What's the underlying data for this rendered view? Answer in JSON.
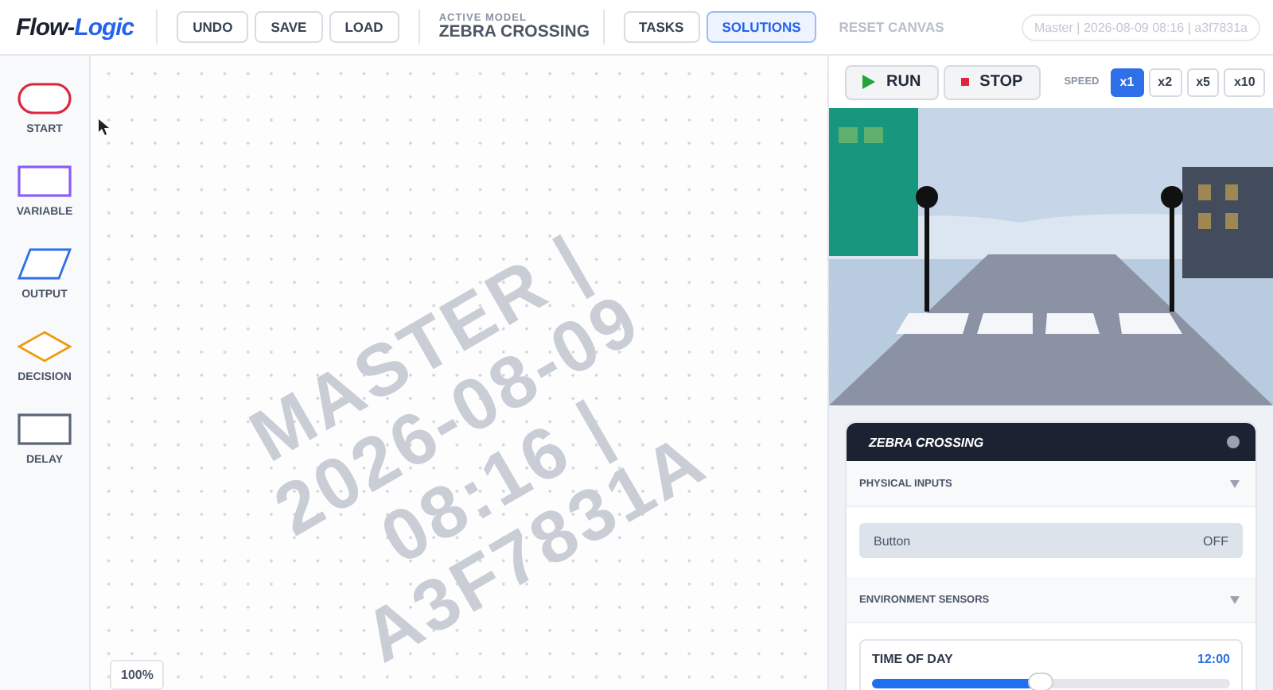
{
  "header": {
    "logo": {
      "part_1": "Flow-",
      "part_2": "Logic"
    },
    "buttons": [
      "UNDO",
      "SAVE",
      "LOAD"
    ],
    "model_label": "ACTIVE MODEL",
    "model_name": "ZEBRA CROSSING",
    "nav": [
      {
        "label": "TASKS",
        "selected": false,
        "disabled": false
      },
      {
        "label": "SOLUTIONS",
        "selected": true,
        "disabled": false
      },
      {
        "label": "RESET CANVAS",
        "selected": false,
        "disabled": true
      }
    ],
    "version": "Master | 2026-08-09 08:16 | a3f7831a"
  },
  "palette": [
    {
      "kind": "start",
      "label": "START"
    },
    {
      "kind": "variable",
      "label": "VARIABLE"
    },
    {
      "kind": "output",
      "label": "OUTPUT"
    },
    {
      "kind": "decision",
      "label": "DECISION"
    },
    {
      "kind": "delay",
      "label": "DELAY"
    }
  ],
  "canvas": {
    "watermark": [
      "MASTER |",
      "2026-08-09",
      "08:16 |",
      "A3F7831A"
    ],
    "zoom": "100%"
  },
  "controls": {
    "run": "RUN",
    "stop": "STOP",
    "speed_label": "SPEED",
    "speeds": [
      {
        "label": "x1",
        "selected": true
      },
      {
        "label": "x2",
        "selected": false
      },
      {
        "label": "x5",
        "selected": false
      },
      {
        "label": "x10",
        "selected": false
      }
    ]
  },
  "panel": {
    "title": "ZEBRA CROSSING",
    "sections": [
      {
        "title": "PHYSICAL INPUTS",
        "expanded": true,
        "items": [
          {
            "kind": "toggle",
            "label": "Button",
            "value": "OFF"
          }
        ]
      },
      {
        "title": "ENVIRONMENT SENSORS",
        "expanded": true,
        "items": [
          {
            "kind": "slider",
            "label": "TIME OF DAY",
            "value": "12:00",
            "level": 0.47
          }
        ]
      }
    ]
  }
}
